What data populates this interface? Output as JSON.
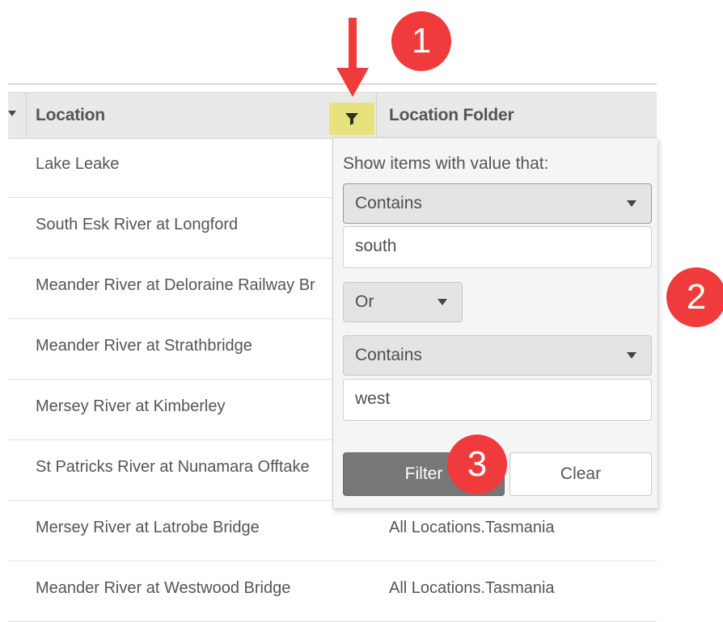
{
  "grid": {
    "columns": {
      "location": "Location",
      "folder": "Location Folder"
    },
    "rows": [
      {
        "location": "Lake Leake",
        "folder": ""
      },
      {
        "location": "South Esk River at Longford",
        "folder": ""
      },
      {
        "location": "Meander River at Deloraine Railway Br",
        "folder": ""
      },
      {
        "location": "Meander River at Strathbridge",
        "folder": ""
      },
      {
        "location": "Mersey River at Kimberley",
        "folder": ""
      },
      {
        "location": "St Patricks River at Nunamara Offtake",
        "folder": ""
      },
      {
        "location": "Mersey River at Latrobe Bridge",
        "folder": "All Locations.Tasmania"
      },
      {
        "location": "Meander River at Westwood Bridge",
        "folder": "All Locations.Tasmania"
      }
    ]
  },
  "filter_popup": {
    "prompt": "Show items with value that:",
    "operator1": "Contains",
    "value1": "south",
    "logic": "Or",
    "operator2": "Contains",
    "value2": "west",
    "filter_label": "Filter",
    "clear_label": "Clear"
  },
  "annotations": {
    "step1": "1",
    "step2": "2",
    "step3": "3"
  },
  "colors": {
    "badge": "#ef3b3b",
    "filter_icon_highlight": "#e6e27c",
    "filter_button": "#777777"
  },
  "icons": {
    "column_filter": "funnel-icon",
    "dropdown": "chevron-down-icon"
  }
}
